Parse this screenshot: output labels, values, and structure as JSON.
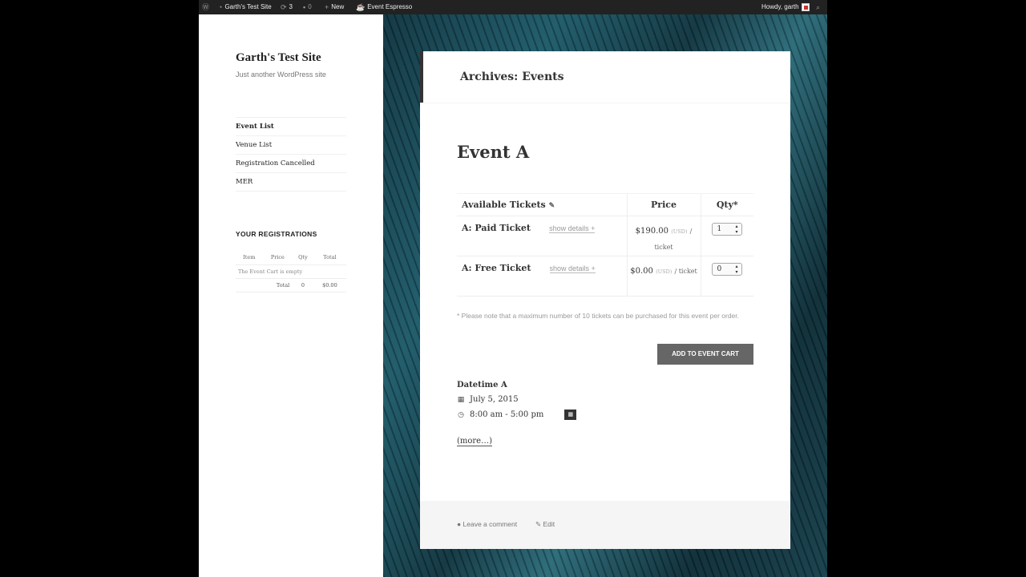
{
  "adminbar": {
    "site_name": "Garth's Test Site",
    "updates_count": "3",
    "comments_count": "0",
    "new_label": "New",
    "plugin_label": "Event Espresso",
    "greeting": "Howdy, garth"
  },
  "sidebar": {
    "site_title": "Garth's Test Site",
    "site_description": "Just another WordPress site",
    "nav": [
      {
        "label": "Event List"
      },
      {
        "label": "Venue List"
      },
      {
        "label": "Registration Cancelled"
      },
      {
        "label": "MER"
      }
    ],
    "widget_title": "YOUR REGISTRATIONS",
    "cart": {
      "headers": [
        "Item",
        "Price",
        "Qty",
        "Total"
      ],
      "empty_text": "The Event Cart is empty",
      "total_label": "Total",
      "total_qty": "0",
      "total_amount": "$0.00"
    }
  },
  "main": {
    "archive_title": "Archives: Events",
    "event_title": "Event A",
    "tickets": {
      "headers": {
        "name": "Available Tickets",
        "price": "Price",
        "qty": "Qty*"
      },
      "rows": [
        {
          "name": "A: Paid Ticket",
          "details": "show details +",
          "price": "$190.00",
          "currency": "(USD)",
          "per": "/ ticket",
          "qty": "1"
        },
        {
          "name": "A: Free Ticket",
          "details": "show details +",
          "price": "$0.00",
          "currency": "(USD)",
          "per": "/ ticket",
          "qty": "0"
        }
      ]
    },
    "note": "* Please note that a maximum number of 10 tickets can be purchased for this event per order.",
    "add_to_cart": "ADD TO EVENT CART",
    "datetime": {
      "title": "Datetime A",
      "date": "July 5, 2015",
      "time": "8:00 am - 5:00 pm"
    },
    "more_link": "(more…)",
    "footer": {
      "comment": "Leave a comment",
      "edit": "Edit"
    }
  }
}
